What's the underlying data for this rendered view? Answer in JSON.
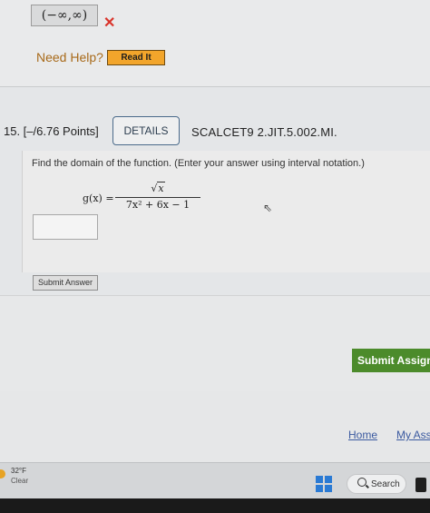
{
  "previous_question": {
    "answer_value": "(−∞,∞)",
    "wrong_mark": "✕",
    "need_help_label": "Need Help?",
    "read_it_label": "Read It"
  },
  "question": {
    "number_points": "15. [–/6.76 Points]",
    "details_label": "DETAILS",
    "code": "SCALCET9 2.JIT.5.002.MI.",
    "instructions": "Find the domain of the function. (Enter your answer using interval notation.)",
    "function_lhs": "g(x) =",
    "numerator_radicand": "x",
    "denominator": "7x² + 6x − 1",
    "answer_value": "",
    "submit_answer_label": "Submit Answer"
  },
  "submit_assignment_label": "Submit Assignm",
  "footer": {
    "home_label": "Home",
    "my_assignments_label": "My Ass"
  },
  "taskbar": {
    "weather_temp": "32°F",
    "weather_desc": "Clear",
    "search_label": "Search"
  },
  "colors": {
    "accent_green": "#4c8b2b",
    "wrong_red": "#d9342b",
    "read_it_orange": "#f2a52b",
    "link_blue": "#3b5aa0"
  }
}
